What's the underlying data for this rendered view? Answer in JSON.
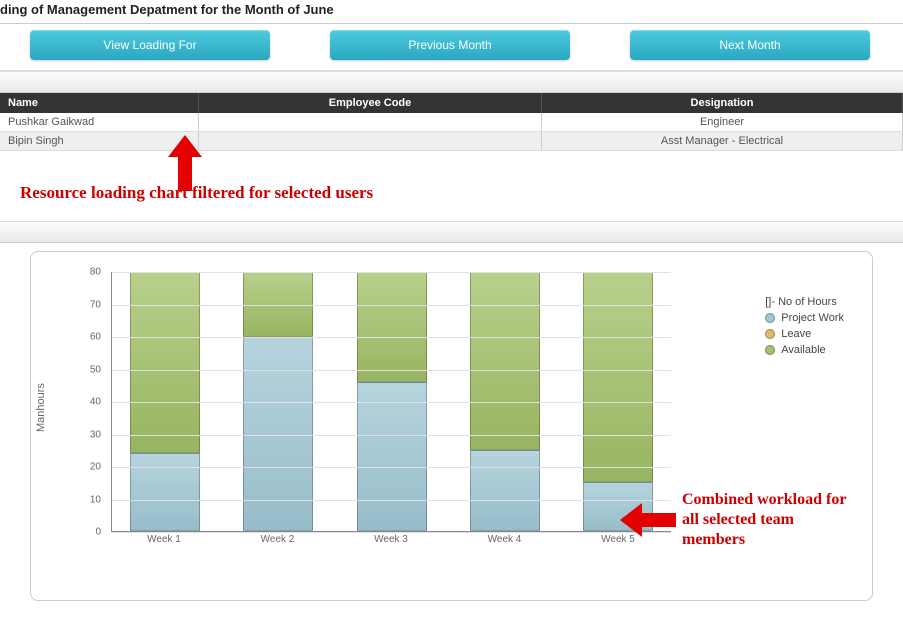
{
  "title": "ding of Management Depatment for the Month of June",
  "buttons": {
    "view_loading": "View Loading For",
    "prev_month": "Previous Month",
    "next_month": "Next Month"
  },
  "table": {
    "headers": {
      "name": "Name",
      "code": "Employee Code",
      "designation": "Designation"
    },
    "rows": [
      {
        "name": "Pushkar Gaikwad",
        "code": "",
        "designation": "Engineer"
      },
      {
        "name": "Bipin Singh",
        "code": "",
        "designation": "Asst Manager - Electrical"
      }
    ]
  },
  "annotations": {
    "filter_note": "Resource loading chart filtered for selected  users",
    "combined_note": "Combined workload for all selected team members"
  },
  "legend": {
    "title": "[]- No of Hours",
    "project_work": "Project Work",
    "leave": "Leave",
    "available": "Available"
  },
  "ylabel": "Manhours",
  "yticks": [
    "0",
    "10",
    "20",
    "30",
    "40",
    "50",
    "60",
    "70",
    "80"
  ],
  "chart_data": {
    "type": "bar",
    "stacked": true,
    "title": "",
    "xlabel": "",
    "ylabel": "Manhours",
    "ylim": [
      0,
      80
    ],
    "categories": [
      "Week 1",
      "Week 2",
      "Week 3",
      "Week 4",
      "Week 5"
    ],
    "series": [
      {
        "name": "Project Work",
        "values": [
          24,
          60,
          46,
          25,
          15
        ]
      },
      {
        "name": "Leave",
        "values": [
          0,
          0,
          0,
          0,
          0
        ]
      },
      {
        "name": "Available",
        "values": [
          56,
          20,
          34,
          55,
          65
        ]
      }
    ],
    "legend_title": "[]- No of Hours"
  }
}
